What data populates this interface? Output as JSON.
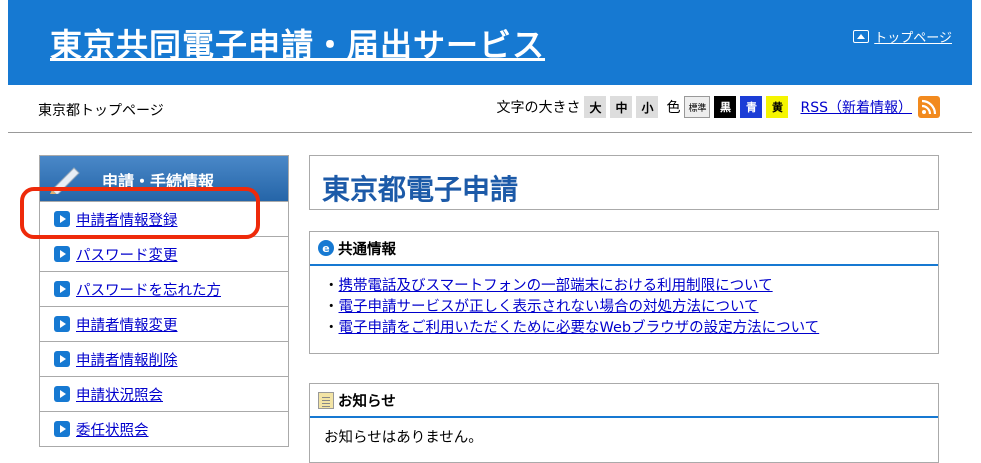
{
  "header": {
    "site_title": "東京共同電子申請・届出サービス",
    "top_page_link": "トップページ"
  },
  "toolbar": {
    "breadcrumb": "東京都トップページ",
    "font_size_label": "文字の大きさ",
    "font_sizes": [
      "大",
      "中",
      "小"
    ],
    "color_label": "色",
    "color_options": [
      "標準",
      "黒",
      "青",
      "黄"
    ],
    "rss_label": "RSS（新着情報）"
  },
  "sidebar": {
    "heading": "申請・手続情報",
    "items": [
      {
        "label": "申請者情報登録"
      },
      {
        "label": "パスワード変更"
      },
      {
        "label": "パスワードを忘れた方"
      },
      {
        "label": "申請者情報変更"
      },
      {
        "label": "申請者情報削除"
      },
      {
        "label": "申請状況照会"
      },
      {
        "label": "委任状照会"
      }
    ]
  },
  "main": {
    "title": "東京都電子申請",
    "common_info": {
      "heading": "共通情報",
      "links": [
        "携帯電話及びスマートフォンの一部端末における利用制限について",
        "電子申請サービスが正しく表示されない場合の対処方法について",
        "電子申請をご利用いただくために必要なWebブラウザの設定方法について"
      ]
    },
    "notice": {
      "heading": "お知らせ",
      "body": "お知らせはありません。"
    }
  },
  "colors": {
    "header_bg": "#1679d2",
    "highlight": "#ee2a0a",
    "title_text": "#1c5aa8"
  }
}
